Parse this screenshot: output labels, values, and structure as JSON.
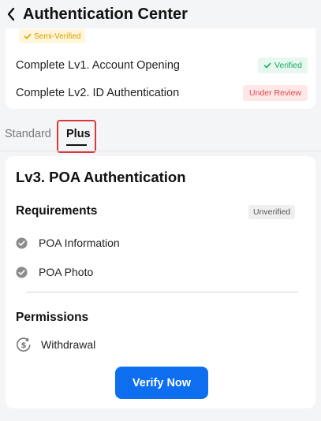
{
  "header": {
    "title": "Authentication Center"
  },
  "status": {
    "semi_verified_label": "Semi-Verified",
    "levels": [
      {
        "label": "Complete Lv1. Account Opening",
        "status": "Verified"
      },
      {
        "label": "Complete Lv2. ID Authentication",
        "status": "Under Review"
      }
    ]
  },
  "tabs": [
    {
      "label": "Standard"
    },
    {
      "label": "Plus"
    }
  ],
  "card": {
    "title": "Lv3. POA Authentication",
    "requirements_title": "Requirements",
    "requirements_status": "Unverified",
    "requirements": [
      {
        "label": "POA Information"
      },
      {
        "label": "POA Photo"
      }
    ],
    "permissions_title": "Permissions",
    "permissions": [
      {
        "label": "Withdrawal",
        "icon": "dollar-circle-icon"
      }
    ],
    "action_label": "Verify Now"
  },
  "colors": {
    "accent": "#0d6ef0",
    "verified": "#1faa6a",
    "under_review": "#e0484a",
    "semi_verified": "#d9a200"
  }
}
